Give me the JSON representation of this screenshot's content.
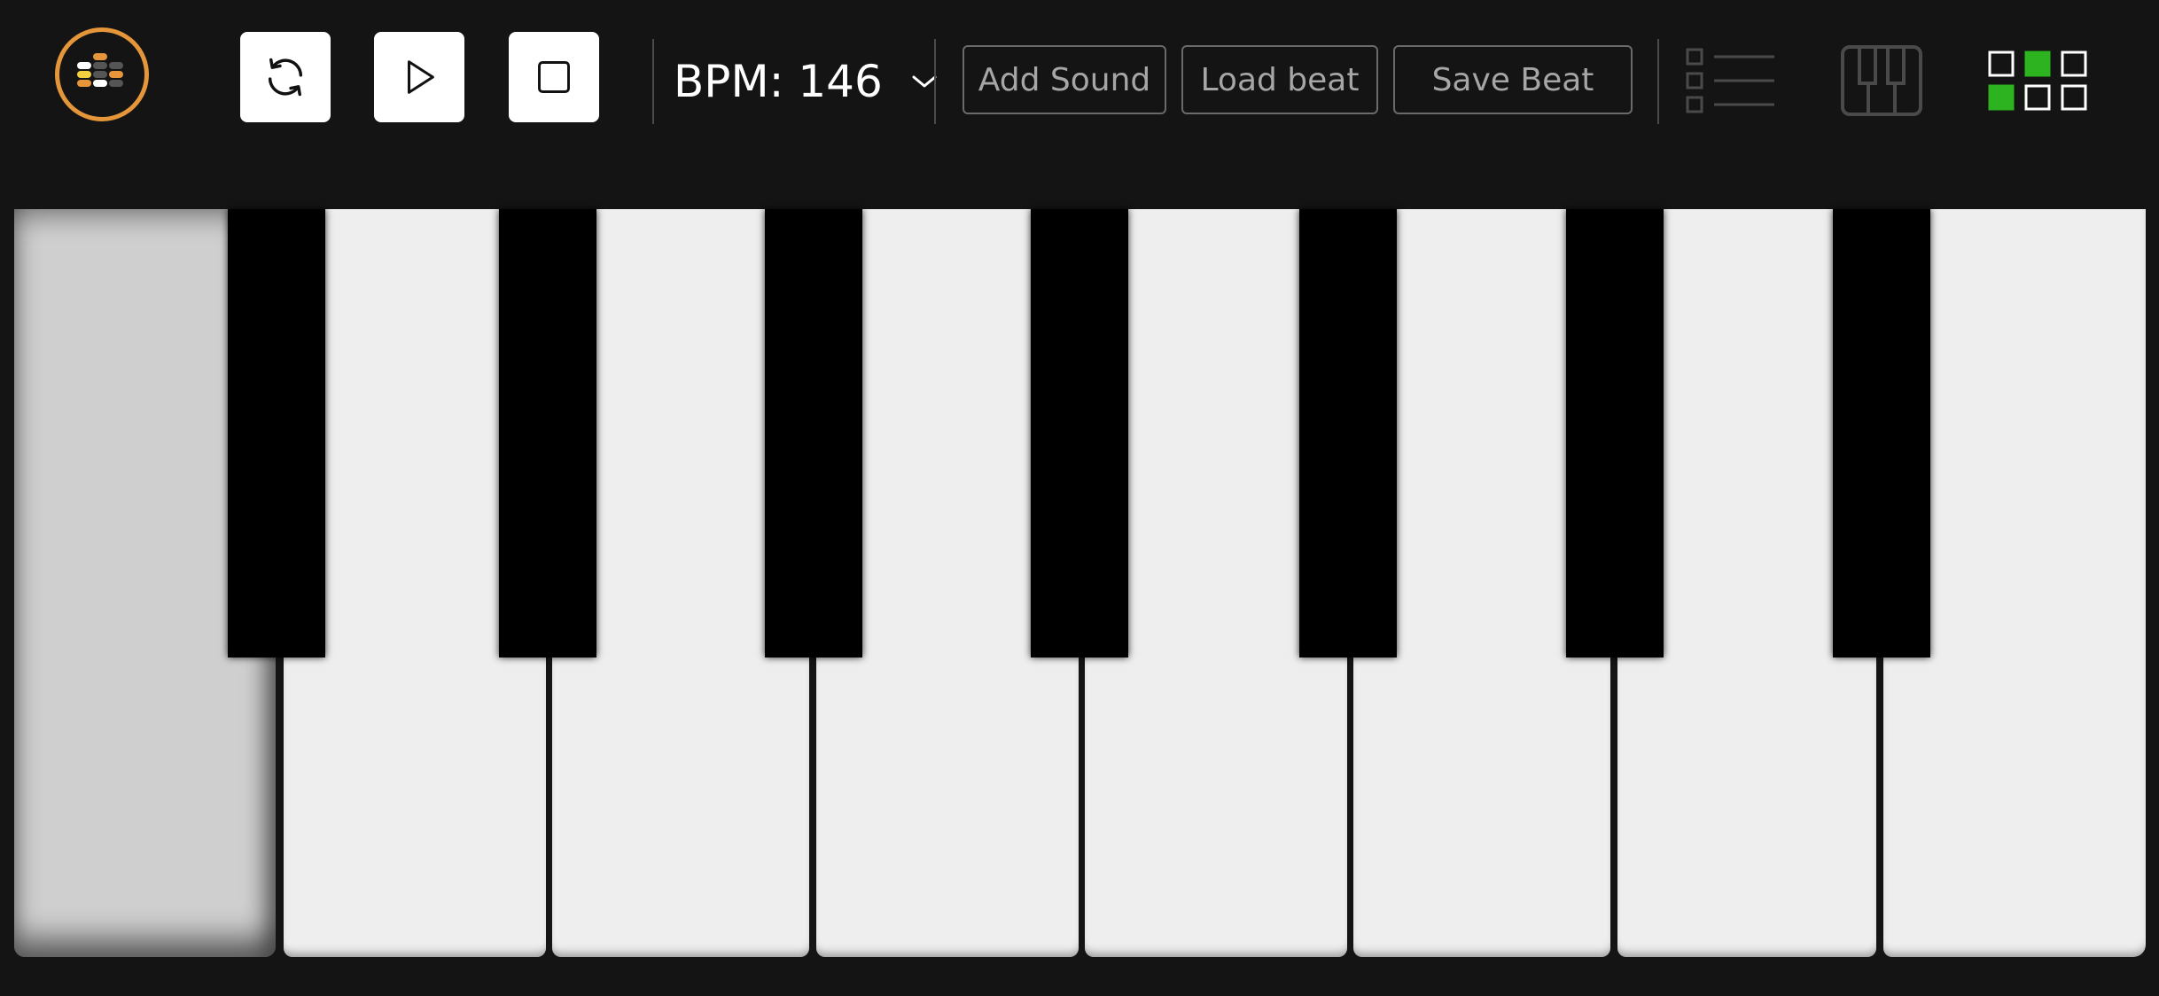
{
  "app": {
    "logo_colors": {
      "ring": "#e5963a",
      "yellow": "#f4d03f",
      "orange": "#e5963a",
      "white": "#ffffff",
      "gray": "#555555"
    }
  },
  "transport": {
    "loop_icon": "refresh-icon",
    "play_icon": "play-icon",
    "stop_icon": "stop-icon"
  },
  "bpm": {
    "label": "BPM: 146",
    "value": 146
  },
  "actions": {
    "add_sound": "Add Sound",
    "load_beat": "Load beat",
    "save_beat": "Save Beat"
  },
  "views": {
    "list_icon": "list-view-icon",
    "piano_icon": "piano-view-icon",
    "grid_icon": "grid-view-icon",
    "grid_active_cells": [
      2,
      4
    ],
    "accent": "#2db31f"
  },
  "keyboard": {
    "white_key_count": 8,
    "black_key_count": 7,
    "pressed_white_keys": [
      0
    ],
    "colors": {
      "white": "#eeeeee",
      "pressed": "#cfcfcf",
      "black": "#000000"
    }
  }
}
